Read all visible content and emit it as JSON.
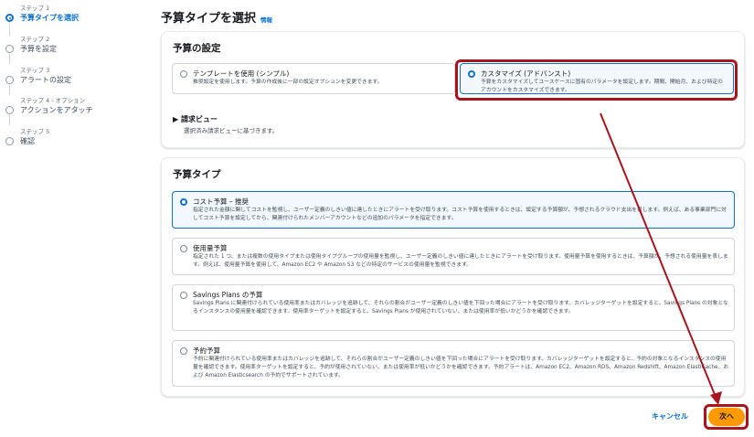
{
  "steps": [
    {
      "num": "ステップ 1",
      "label": "予算タイプを選択",
      "active": true
    },
    {
      "num": "ステップ 2",
      "label": "予算を設定",
      "active": false
    },
    {
      "num": "ステップ 3",
      "label": "アラートの設定",
      "active": false
    },
    {
      "num": "ステップ 4 - オプション",
      "label": "アクションをアタッチ",
      "active": false
    },
    {
      "num": "ステップ 5",
      "label": "確認",
      "active": false
    }
  ],
  "header": {
    "title": "予算タイプを選択",
    "info": "情報"
  },
  "budget_setup": {
    "title": "予算の設定",
    "options": [
      {
        "title": "テンプレートを使用 (シンプル)",
        "desc": "推奨設定を使用します。予算の作成後に一部の設定オプションを変更できます。",
        "selected": false
      },
      {
        "title": "カスタマイズ (アドバンスト)",
        "desc": "予算をカスタマイズしてユースケースに固有のパラメータを設定します。期間、開始月、および特定のアカウントをカスタマイズできます。",
        "selected": true
      }
    ],
    "billing_view": {
      "label": "請求ビュー",
      "desc": "選択済み請求ビューに基づきます。"
    }
  },
  "budget_types": {
    "title": "予算タイプ",
    "options": [
      {
        "title": "コスト予算 – 推奨",
        "desc": "指定された金額に関してコストを監視し、ユーザー定義のしきい値に達したときにアラートを受け取ります。コスト予算を使用するときは、設定する予算額が、予想されるクラウド支出を表します。例えば、ある事業部門に対してコスト予算を設定してから、関連付けられたメンバーアカウントなどの追加のパラメータを指定できます。",
        "selected": true
      },
      {
        "title": "使用量予算",
        "desc": "指定された 1 つ、または複数の使用タイプまたは使用タイプグループの使用量を監視し、ユーザー定義のしきい値に達したときにアラートを受け取ります。使用量予算を使用するときは、予算額が、予想される使用量を表します。例えば、使用量予算を使用して、Amazon EC2 や Amazon S3 などの特定のサービスの使用量を監視できます。",
        "selected": false
      },
      {
        "title": "Savings Plans の予算",
        "desc": "Savings Plans に関連付けられている使用率またはカバレッジを追跡して、それらの割合がユーザー定義のしきい値を下回った場合にアラートを受け取ります。カバレッジターゲットを設定すると、Savings Plans の対象となるインスタンスの使用量を確認できます。使用率ターゲットを設定すると、Savings Plans が使用されていない、または使用率が低いかどうかを確認できます。",
        "selected": false
      },
      {
        "title": "予約予算",
        "desc": "予約に関連付けられている使用率またはカバレッジを追跡して、それらの割合がユーザー定義のしきい値を下回った場合にアラートを受け取ります。カバレッジターゲットを設定すると、予約の対象となるインスタンスの使用量を確認できます。使用率ターゲットを設定すると、予約が使用されていない、または使用率が低いかどうかを確認できます。予約アラートは、Amazon EC2、Amazon RDS、Amazon Redshift、Amazon ElastiCache、および Amazon Elasticsearch の予約でサポートされています。",
        "selected": false
      }
    ]
  },
  "footer": {
    "cancel": "キャンセル",
    "next": "次へ"
  },
  "colors": {
    "accent": "#0972d3",
    "primary_button": "#ff9900",
    "annotation": "#a8151d"
  }
}
